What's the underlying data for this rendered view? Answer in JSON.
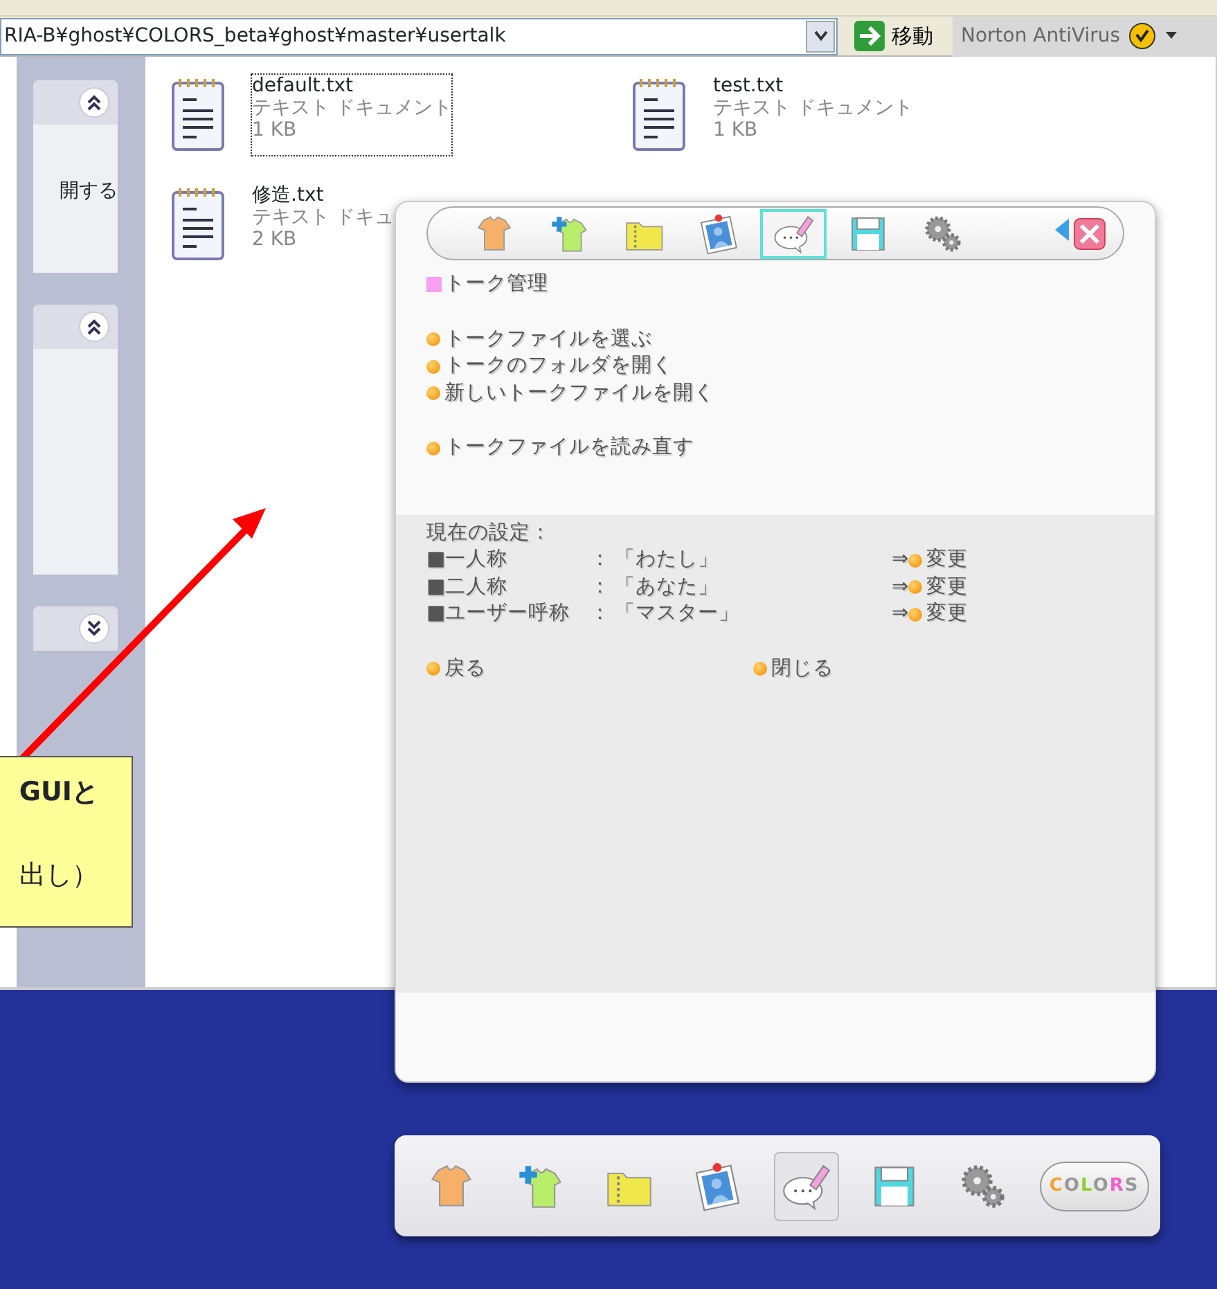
{
  "address_bar": {
    "path": "RIA-B¥ghost¥COLORS_beta¥ghost¥master¥usertalk",
    "go_label": "移動",
    "antivirus": "Norton AntiVirus"
  },
  "sidebar": {
    "panels": [
      {
        "expanded": true,
        "items": [
          "開する"
        ]
      },
      {
        "expanded": true
      },
      {
        "expanded": false
      }
    ]
  },
  "files": [
    {
      "name": "default.txt",
      "type": "テキスト ドキュメント",
      "size": "1 KB",
      "selected": true
    },
    {
      "name": "test.txt",
      "type": "テキスト ドキュメント",
      "size": "1 KB",
      "selected": false
    },
    {
      "name": "修造.txt",
      "type": "テキスト ドキュ",
      "size": "2 KB",
      "selected": false
    }
  ],
  "talk_panel": {
    "toolbar": [
      {
        "kind": "shirt",
        "selected": false
      },
      {
        "kind": "shirt-add",
        "selected": false
      },
      {
        "kind": "folder",
        "selected": false
      },
      {
        "kind": "photo",
        "selected": false
      },
      {
        "kind": "talk",
        "selected": true
      },
      {
        "kind": "save",
        "selected": false
      },
      {
        "kind": "gears",
        "selected": false
      }
    ],
    "heading": "トーク管理",
    "action_groups": [
      [
        "トークファイルを選ぶ",
        "トークのフォルダを開く",
        "新しいトークファイルを開く"
      ],
      [
        "トークファイルを読み直す"
      ]
    ],
    "settings_title": "現在の設定：",
    "settings": [
      {
        "label": "■一人称",
        "colon": "：",
        "value": "「わたし」",
        "arrow": "⇒",
        "change": "変更"
      },
      {
        "label": "■二人称",
        "colon": "：",
        "value": "「あなた」",
        "arrow": "⇒",
        "change": "変更"
      },
      {
        "label": "■ユーザー呼称",
        "colon": "：",
        "value": "「マスター」",
        "arrow": "⇒",
        "change": "変更"
      }
    ],
    "footer": [
      "戻る",
      "閉じる"
    ]
  },
  "dock": {
    "items": [
      {
        "kind": "shirt",
        "selected": false
      },
      {
        "kind": "shirt-add",
        "selected": false
      },
      {
        "kind": "folder",
        "selected": false
      },
      {
        "kind": "photo",
        "selected": false
      },
      {
        "kind": "talk",
        "selected": true
      },
      {
        "kind": "save",
        "selected": false
      },
      {
        "kind": "gears",
        "selected": false
      }
    ],
    "logo": "COLORS"
  },
  "callout": {
    "lines": [
      "GUIと",
      "出し）"
    ]
  }
}
